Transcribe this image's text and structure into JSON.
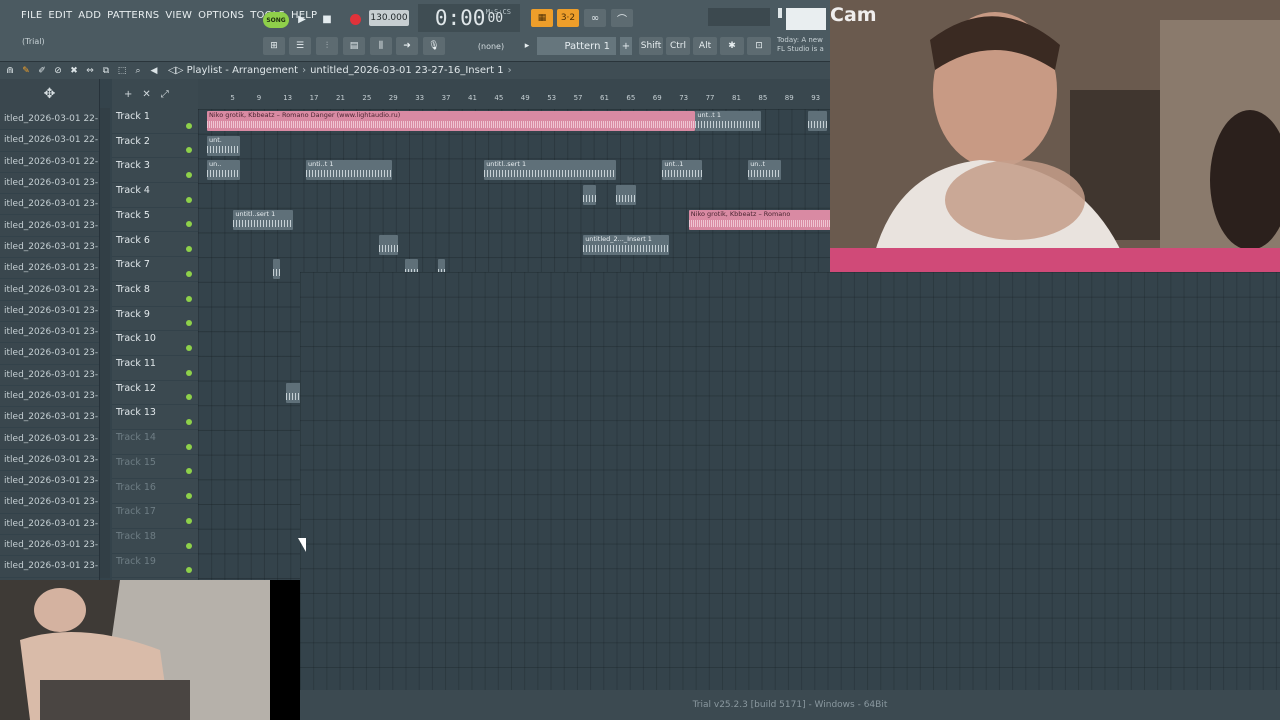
{
  "menu": [
    "FILE",
    "EDIT",
    "ADD",
    "PATTERNS",
    "VIEW",
    "OPTIONS",
    "TOOLS",
    "HELP"
  ],
  "trial_label": "(Trial)",
  "transport": {
    "song_label": "SONG",
    "tempo": "130.000",
    "time": "0:00",
    "time_sub": "00",
    "time_mode": "M:S:CS"
  },
  "pattern_selector": "(none)",
  "pattern": "Pattern 1",
  "modifier_keys": [
    "Shift",
    "Ctrl",
    "Alt"
  ],
  "news": [
    "Today: A new",
    "FL Studio is a"
  ],
  "playlist": {
    "title": "Playlist - Arrangement",
    "file": "untitled_2026-03-01 23-27-16_Insert 1"
  },
  "picker_items": [
    "itled_2026-03-01 22-",
    "itled_2026-03-01 22-",
    "itled_2026-03-01 22-",
    "itled_2026-03-01 23-",
    "itled_2026-03-01 23-",
    "itled_2026-03-01 23-",
    "itled_2026-03-01 23-",
    "itled_2026-03-01 23-",
    "itled_2026-03-01 23-",
    "itled_2026-03-01 23-",
    "itled_2026-03-01 23-",
    "itled_2026-03-01 23-",
    "itled_2026-03-01 23-",
    "itled_2026-03-01 23-",
    "itled_2026-03-01 23-",
    "itled_2026-03-01 23-",
    "itled_2026-03-01 23-",
    "itled_2026-03-01 23-",
    "itled_2026-03-01 23-",
    "itled_2026-03-01 23-",
    "itled_2026-03-01 23-",
    "itled_2026-03-01 23-"
  ],
  "tracks": [
    {
      "name": "Track 1",
      "active": true
    },
    {
      "name": "Track 2",
      "active": true
    },
    {
      "name": "Track 3",
      "active": true
    },
    {
      "name": "Track 4",
      "active": true
    },
    {
      "name": "Track 5",
      "active": true
    },
    {
      "name": "Track 6",
      "active": true
    },
    {
      "name": "Track 7",
      "active": true
    },
    {
      "name": "Track 8",
      "active": true
    },
    {
      "name": "Track 9",
      "active": true
    },
    {
      "name": "Track 10",
      "active": true
    },
    {
      "name": "Track 11",
      "active": true
    },
    {
      "name": "Track 12",
      "active": true
    },
    {
      "name": "Track 13",
      "active": true
    },
    {
      "name": "Track 14",
      "active": false
    },
    {
      "name": "Track 15",
      "active": false
    },
    {
      "name": "Track 16",
      "active": false
    },
    {
      "name": "Track 17",
      "active": false
    },
    {
      "name": "Track 18",
      "active": false
    },
    {
      "name": "Track 19",
      "active": false
    }
  ],
  "ruler_ticks": [
    "5",
    "9",
    "13",
    "17",
    "21",
    "25",
    "29",
    "33",
    "37",
    "41",
    "45",
    "49",
    "53",
    "57",
    "61",
    "65",
    "69",
    "73",
    "77",
    "81",
    "85",
    "89",
    "93"
  ],
  "clips": [
    {
      "track": 0,
      "bar": 1,
      "len": 74,
      "label": "Niko grotik, Kbbeatz – Romano Danger (www.lightaudio.ru)",
      "pink": true
    },
    {
      "track": 0,
      "bar": 75,
      "len": 10,
      "label": "unt..t 1",
      "pink": false
    },
    {
      "track": 0,
      "bar": 92,
      "len": 3,
      "label": "",
      "pink": false
    },
    {
      "track": 1,
      "bar": 1,
      "len": 5,
      "label": "unt.",
      "pink": false
    },
    {
      "track": 2,
      "bar": 1,
      "len": 5,
      "label": "un..",
      "pink": false
    },
    {
      "track": 2,
      "bar": 16,
      "len": 13,
      "label": "unti..t 1",
      "pink": false
    },
    {
      "track": 2,
      "bar": 43,
      "len": 20,
      "label": "untitl..sert 1",
      "pink": false
    },
    {
      "track": 2,
      "bar": 70,
      "len": 6,
      "label": "unt..1",
      "pink": false
    },
    {
      "track": 2,
      "bar": 83,
      "len": 5,
      "label": "un..t",
      "pink": false
    },
    {
      "track": 3,
      "bar": 58,
      "len": 2,
      "label": "",
      "pink": false
    },
    {
      "track": 3,
      "bar": 63,
      "len": 3,
      "label": "",
      "pink": false
    },
    {
      "track": 4,
      "bar": 5,
      "len": 9,
      "label": "untitl..sert 1",
      "pink": false
    },
    {
      "track": 4,
      "bar": 74,
      "len": 22,
      "label": "Niko grotik, Kbbeatz – Romano",
      "pink": true
    },
    {
      "track": 5,
      "bar": 58,
      "len": 13,
      "label": "untitled_2..._Insert 1",
      "pink": false
    },
    {
      "track": 5,
      "bar": 27,
      "len": 3,
      "label": "",
      "pink": false
    },
    {
      "track": 6,
      "bar": 11,
      "len": 1,
      "label": "",
      "pink": false
    },
    {
      "track": 6,
      "bar": 31,
      "len": 2,
      "label": "",
      "pink": false
    },
    {
      "track": 6,
      "bar": 36,
      "len": 1,
      "label": "",
      "pink": false
    },
    {
      "track": 7,
      "bar": 26,
      "len": 2,
      "label": "",
      "pink": false
    },
    {
      "track": 7,
      "bar": 40,
      "len": 2,
      "label": "",
      "pink": false
    },
    {
      "track": 8,
      "bar": 30,
      "len": 5,
      "label": "",
      "pink": false
    },
    {
      "track": 8,
      "bar": 42,
      "len": 2,
      "label": "",
      "pink": false
    },
    {
      "track": 9,
      "bar": 37,
      "len": 4,
      "label": "",
      "pink": false
    },
    {
      "track": 9,
      "bar": 95,
      "len": 3,
      "label": "",
      "pink": false
    },
    {
      "track": 10,
      "bar": 36,
      "len": 2,
      "label": "",
      "pink": false
    },
    {
      "track": 11,
      "bar": 13,
      "len": 3,
      "label": "",
      "pink": false
    },
    {
      "track": 11,
      "bar": 21,
      "len": 2,
      "label": "",
      "pink": false
    },
    {
      "track": 12,
      "bar": 21,
      "len": 1,
      "label": "",
      "pink": false
    }
  ],
  "webcam_label": "Cam",
  "status_bar": "Trial v25.2.3 [build 5171] - Windows - 64Bit"
}
